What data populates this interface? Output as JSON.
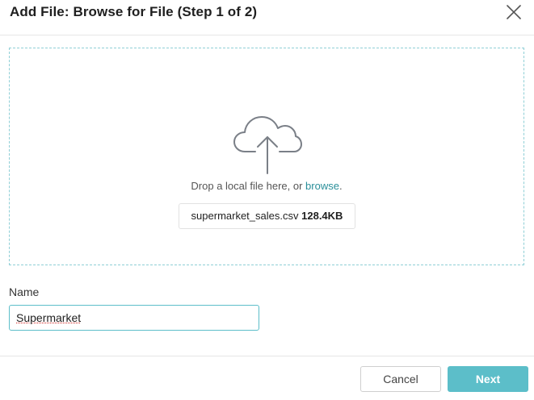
{
  "dialog": {
    "title": "Add File: Browse for File (Step 1 of 2)",
    "close_icon": "close-icon"
  },
  "dropzone": {
    "icon": "cloud-upload-icon",
    "prompt_prefix": "Drop a local file here, or ",
    "browse_label": "browse",
    "prompt_suffix": ".",
    "file_name": "supermarket_sales.csv",
    "file_size": "128.4KB"
  },
  "name_field": {
    "label": "Name",
    "value": "Supermarket"
  },
  "footer": {
    "cancel_label": "Cancel",
    "next_label": "Next"
  },
  "colors": {
    "accent": "#5cbec9",
    "link": "#2a8f9a",
    "dropzone_border": "#8fcfd6"
  }
}
